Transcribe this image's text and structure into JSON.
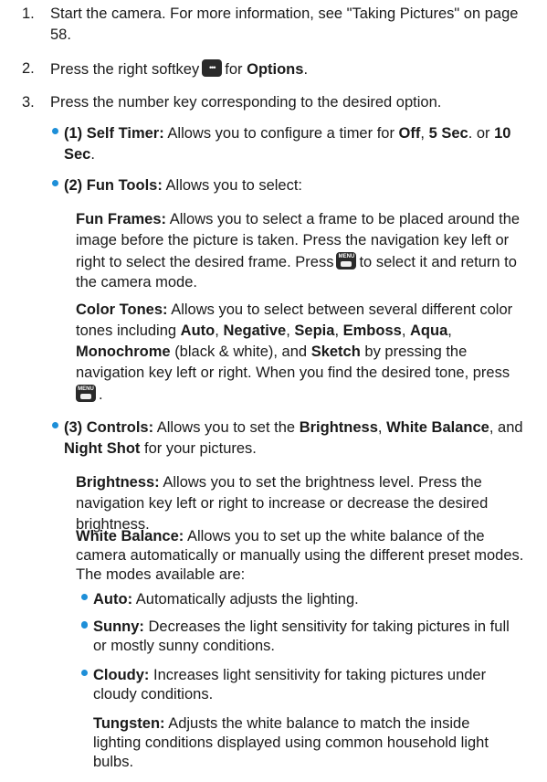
{
  "steps": [
    {
      "num": "1.",
      "text": "Start the camera. For more information, see \"Taking Pictures\" on page",
      "text2": "58."
    },
    {
      "num": "2.",
      "pre": "Press the right softkey",
      "icon": "softkey-dots-icon",
      "post": "for",
      "bold": "Options",
      "end": "."
    },
    {
      "num": "3.",
      "text": "Press the number key corresponding to the desired option."
    }
  ],
  "self_timer": {
    "label": "(1) Self Timer:",
    "t1": "Allows you to configure a timer for",
    "off": "Off",
    "comma": ",",
    "five": "5 Sec",
    "or": ". or",
    "ten": "10",
    "sec": "Sec",
    "end": "."
  },
  "fun_tools": {
    "label": "(2) Fun Tools:",
    "text": "Allows you to select:"
  },
  "fun_frames": {
    "label": "Fun Frames:",
    "l1": "Allows you to select a frame to be placed around the",
    "l2": "image before the picture is taken. Press the navigation key left or",
    "l3a": "right to select the desired frame. Press",
    "l3b": "to select it and return to",
    "l4": "the camera mode."
  },
  "color_tones": {
    "label": "Color Tones:",
    "l1": "Allows you to select between several different color",
    "l2a": "tones including",
    "auto": "Auto",
    "negative": "Negative",
    "sepia": "Sepia",
    "emboss": "Emboss",
    "aqua": "Aqua",
    "monochrome": "Monochrome",
    "l3a": "(black & white), and",
    "sketch": "Sketch",
    "l3b": "by pressing the",
    "l4": "navigation key left or right. When you find the desired tone, press",
    "sep": ",",
    "end": "."
  },
  "controls": {
    "label": "(3) Controls:",
    "t1": "Allows you to set the",
    "brightness": "Brightness",
    "comma": ",",
    "white": "White Balance",
    "and": ", and",
    "night": "Night Shot",
    "t2": "for your pictures."
  },
  "brightness": {
    "label": "Brightness:",
    "l1": "Allows you to set the brightness level. Press the",
    "l2": "navigation key left or right to increase or decrease the desired",
    "l3": "brightness."
  },
  "white_balance": {
    "label": "White Balance:",
    "l1": "Allows you to set up the white balance of the",
    "l2": "camera automatically or manually using the different preset modes.",
    "l3": "The modes available are:"
  },
  "modes": [
    {
      "label": "Auto:",
      "l1": "Automatically adjusts the lighting."
    },
    {
      "label": "Sunny:",
      "l1": "Decreases the light sensitivity for taking pictures in full",
      "l2": "or mostly sunny conditions."
    },
    {
      "label": "Cloudy:",
      "l1": "Increases light sensitivity for taking pictures under",
      "l2": "cloudy conditions."
    },
    {
      "label": "Tungsten:",
      "l1": "Adjusts the white balance to match the inside",
      "l2": "lighting conditions displayed using common household light",
      "l3": "bulbs."
    }
  ]
}
